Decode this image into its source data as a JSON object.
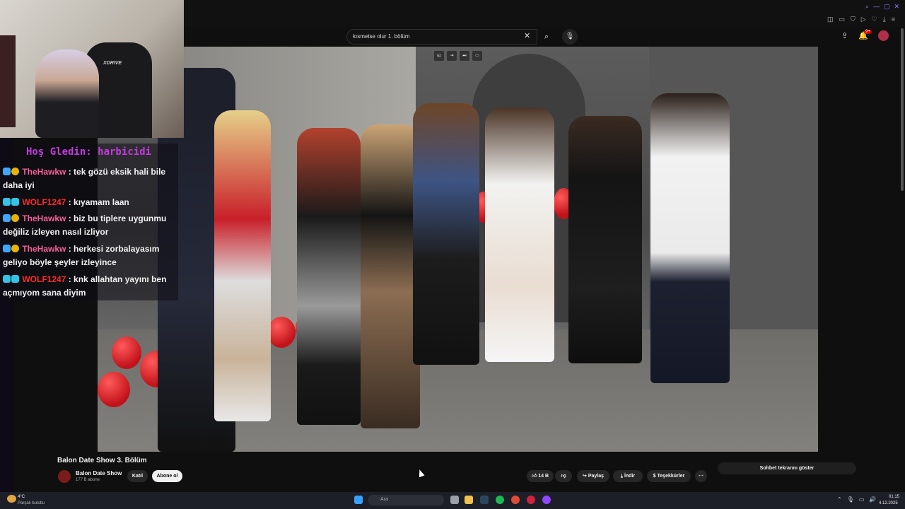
{
  "search": {
    "query": "kısmetse olur 1. bölüm"
  },
  "overlay": {
    "welcome_text": "Hoş Gledin: harbicidi"
  },
  "chat": {
    "messages": [
      {
        "user": "TheHawkw",
        "text": ": tek gözü eksik hali bile daha iyi"
      },
      {
        "user": "WOLF1247",
        "text": ": kıyamam laan"
      },
      {
        "user": "TheHawkw",
        "text": ": biz bu tiplere uygunmu değiliz izleyen nasıl izliyor"
      },
      {
        "user": "TheHawkw",
        "text": ": herkesi zorbalayasım geliyo böyle şeyler izleyince"
      },
      {
        "user": "WOLF1247",
        "text": ": knk allahtan yayını ben açmıyom sana diyim"
      }
    ]
  },
  "webcam": {
    "chair_brand": "XDRIVE"
  },
  "video": {
    "title": "Balon Date Show 3. Bölüm",
    "channel_name": "Balon Date Show",
    "subscribers": "177 B abone",
    "join_label": "Katıl",
    "subscribe_label": "Abone ol",
    "likes": "14 B",
    "share_label": "Paylaş",
    "download_label": "İndir",
    "thanks_label": "Teşekkürler"
  },
  "notifications": {
    "count": "9+"
  },
  "chat_replay": {
    "label": "Sohbet tekrarını göster"
  },
  "taskbar": {
    "temperature": "4°C",
    "weather_desc": "Parçalı bulutlu",
    "search_placeholder": "Ara",
    "time": "01:15",
    "date": "4.12.2025"
  },
  "colors": {
    "accent_overlay": "#c43be0",
    "user1": "#f5609a",
    "user2": "#ff2a2a",
    "background": "#0f0f0f"
  }
}
